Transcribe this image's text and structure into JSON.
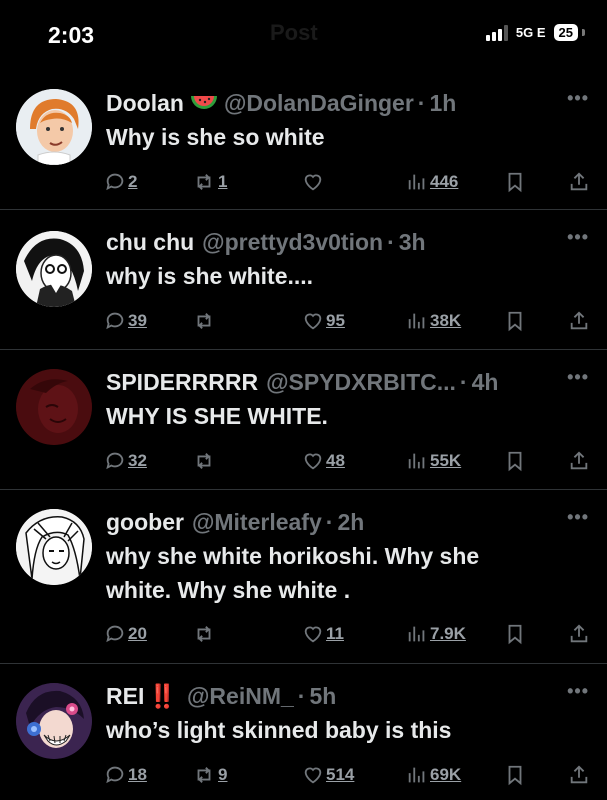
{
  "status_bar": {
    "time": "2:03",
    "faded_title": "Post",
    "network": "5G E",
    "battery": "25"
  },
  "colors": {
    "background": "#000000",
    "text": "#e7e9ea",
    "secondary": "#71767b",
    "divider": "#2f3336"
  },
  "tweets": [
    {
      "name": "Doolan",
      "emoji": "watermelon-emoji",
      "handle": "@DolanDaGinger",
      "sep": "·",
      "ago": "1h",
      "text": [
        "Why is she so white"
      ],
      "replies": "2",
      "reposts": "1",
      "likes": "",
      "views": "446"
    },
    {
      "name": "chu chu",
      "emoji": "",
      "handle": "@prettyd3v0tion",
      "sep": "·",
      "ago": "3h",
      "text": [
        "why is she white...."
      ],
      "replies": "39",
      "reposts": "",
      "likes": "95",
      "views": "38K"
    },
    {
      "name": "SPIDERRRRR",
      "emoji": "",
      "handle": "@SPYDXRBITC...",
      "sep": "·",
      "ago": "4h",
      "text": [
        "WHY IS SHE WHITE."
      ],
      "replies": "32",
      "reposts": "",
      "likes": "48",
      "views": "55K"
    },
    {
      "name": "goober",
      "emoji": "",
      "handle": "@Miterleafy",
      "sep": "·",
      "ago": "2h",
      "text": [
        "why she white horikoshi. Why she",
        "white. Why she white ."
      ],
      "replies": "20",
      "reposts": "",
      "likes": "11",
      "views": "7.9K"
    },
    {
      "name": "REI",
      "emoji": "‼️",
      "handle": "@ReiNM_",
      "sep": "·",
      "ago": "5h",
      "text": [
        "who’s light skinned baby is this"
      ],
      "replies": "18",
      "reposts": "9",
      "likes": "514",
      "views": "69K"
    }
  ]
}
